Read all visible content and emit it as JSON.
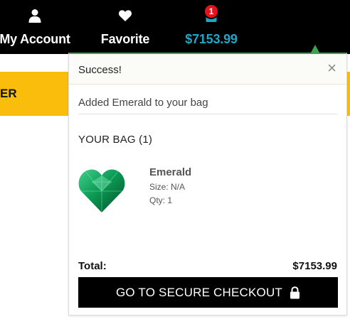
{
  "header": {
    "account_label": "My Account",
    "favorite_label": "Favorite",
    "cart_total": "$7153.99",
    "cart_count": "1",
    "account_icon": "user-icon",
    "favorite_icon": "heart-icon",
    "cart_icon": "shopping-bag-icon"
  },
  "banner": {
    "text": "ER"
  },
  "popup": {
    "title": "Success!",
    "close_symbol": "×",
    "message": "Added Emerald to your bag",
    "bag_heading": "YOUR BAG (1)",
    "item": {
      "name": "Emerald",
      "size": "Size: N/A",
      "qty": "Qty: 1",
      "image": "emerald-heart-gem"
    },
    "total_label": "Total:",
    "total_value": "$7153.99",
    "checkout_label": "GO TO SECURE CHECKOUT",
    "checkout_icon": "lock-icon"
  },
  "colors": {
    "topbar": "#000000",
    "cart_accent": "#1ea6c8",
    "badge": "#e3121b",
    "banner": "#fbbd0c",
    "popup_accent": "#3fa34d",
    "button": "#000000"
  }
}
